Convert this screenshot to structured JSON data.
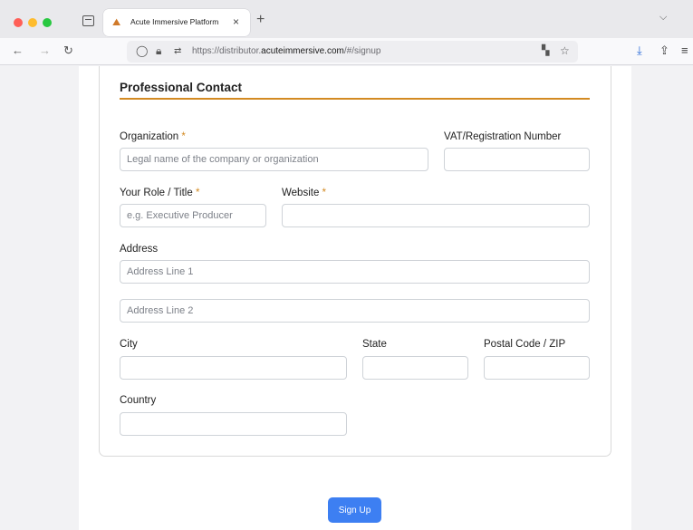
{
  "browser": {
    "tab_title": "Acute Immersive Platform",
    "tab_close": "×",
    "new_tab": "+",
    "url_prefix": "https://distributor.",
    "url_domain": "acuteimmersive.com",
    "url_path": "/#/signup"
  },
  "form": {
    "section_title": "Professional Contact",
    "required_marker": "*",
    "organization": {
      "label": "Organization",
      "placeholder": "Legal name of the company or organization",
      "value": ""
    },
    "vat": {
      "label": "VAT/Registration Number",
      "value": ""
    },
    "role": {
      "label": "Your Role / Title",
      "placeholder": "e.g. Executive Producer",
      "value": ""
    },
    "website": {
      "label": "Website",
      "value": ""
    },
    "address": {
      "label": "Address",
      "line1_placeholder": "Address Line 1",
      "line2_placeholder": "Address Line 2"
    },
    "city": {
      "label": "City",
      "value": ""
    },
    "state": {
      "label": "State",
      "value": ""
    },
    "postal": {
      "label": "Postal Code / ZIP",
      "value": ""
    },
    "country": {
      "label": "Country",
      "value": ""
    },
    "submit_label": "Sign Up"
  },
  "colors": {
    "accent": "#d38a22",
    "button": "#3d7ff2"
  }
}
